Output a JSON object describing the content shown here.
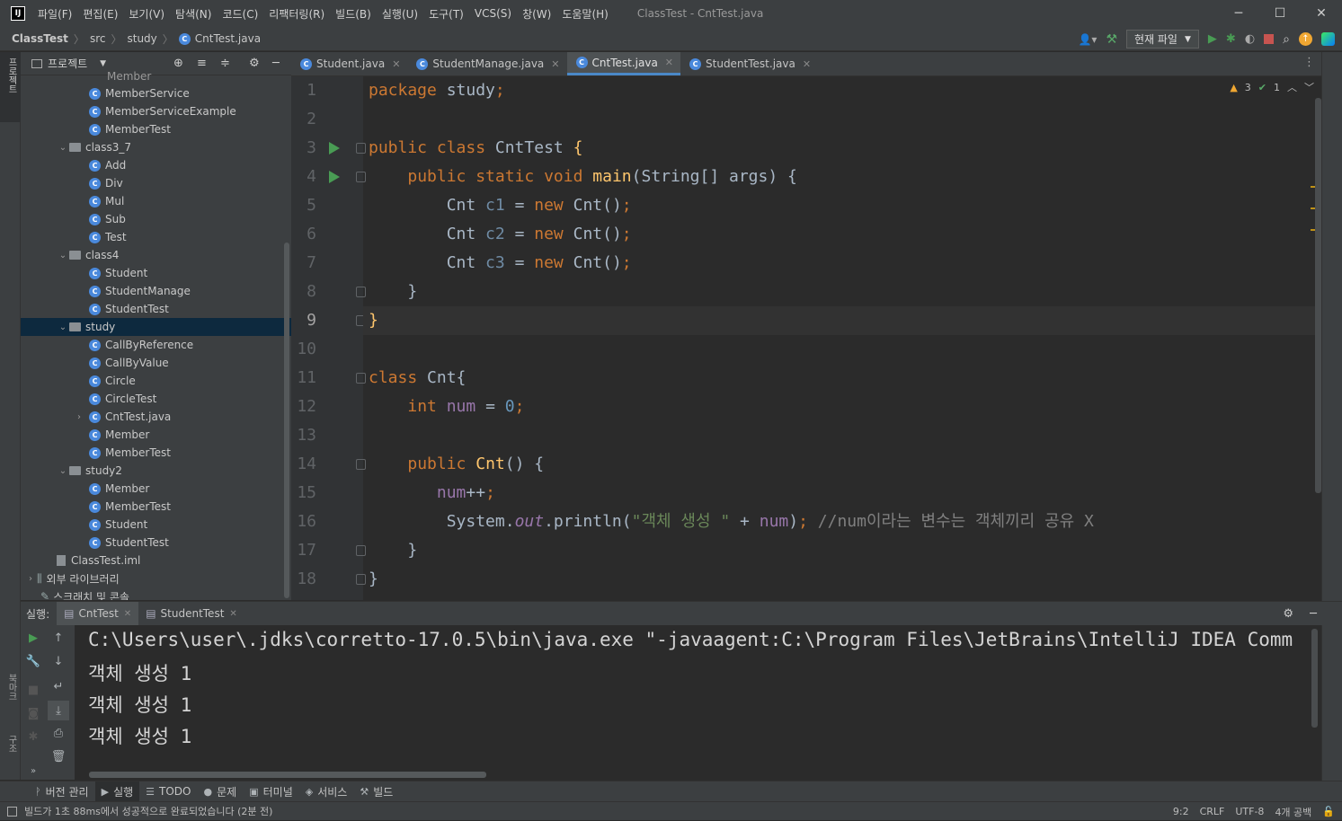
{
  "titlebar": {
    "logo": "IJ",
    "menu": [
      "파일(F)",
      "편집(E)",
      "보기(V)",
      "탐색(N)",
      "코드(C)",
      "리팩터링(R)",
      "빌드(B)",
      "실행(U)",
      "도구(T)",
      "VCS(S)",
      "창(W)",
      "도움말(H)"
    ],
    "title": "ClassTest - CntTest.java",
    "minimize": "─",
    "maximize": "☐",
    "close": "✕"
  },
  "navbar": {
    "crumbs": [
      "ClassTest",
      "src",
      "study",
      "CntTest.java"
    ],
    "run_config": "현재 파일"
  },
  "left_stripe": {
    "project_label": "프로젝트",
    "bookmarks_label": "북마크",
    "structure_label": "구조"
  },
  "project": {
    "title": "프로젝트",
    "tree": [
      {
        "label": "MemberService",
        "type": "class",
        "depth": 2
      },
      {
        "label": "MemberServiceExample",
        "type": "class",
        "depth": 2
      },
      {
        "label": "MemberTest",
        "type": "class",
        "depth": 2
      },
      {
        "label": "class3_7",
        "type": "package",
        "depth": 1,
        "expanded": true
      },
      {
        "label": "Add",
        "type": "class",
        "depth": 2
      },
      {
        "label": "Div",
        "type": "class",
        "depth": 2
      },
      {
        "label": "Mul",
        "type": "class",
        "depth": 2
      },
      {
        "label": "Sub",
        "type": "class",
        "depth": 2
      },
      {
        "label": "Test",
        "type": "class",
        "depth": 2
      },
      {
        "label": "class4",
        "type": "package",
        "depth": 1,
        "expanded": true
      },
      {
        "label": "Student",
        "type": "class",
        "depth": 2
      },
      {
        "label": "StudentManage",
        "type": "class",
        "depth": 2
      },
      {
        "label": "StudentTest",
        "type": "class",
        "depth": 2
      },
      {
        "label": "study",
        "type": "package",
        "depth": 1,
        "expanded": true,
        "selected": true
      },
      {
        "label": "CallByReference",
        "type": "class",
        "depth": 2
      },
      {
        "label": "CallByValue",
        "type": "class",
        "depth": 2
      },
      {
        "label": "Circle",
        "type": "class",
        "depth": 2
      },
      {
        "label": "CircleTest",
        "type": "class",
        "depth": 2
      },
      {
        "label": "CntTest.java",
        "type": "file",
        "depth": 2,
        "collapsed": true
      },
      {
        "label": "Member",
        "type": "class",
        "depth": 2
      },
      {
        "label": "MemberTest",
        "type": "class",
        "depth": 2
      },
      {
        "label": "study2",
        "type": "package",
        "depth": 1,
        "expanded": true
      },
      {
        "label": "Member",
        "type": "class",
        "depth": 2
      },
      {
        "label": "MemberTest",
        "type": "class",
        "depth": 2
      },
      {
        "label": "Student",
        "type": "class",
        "depth": 2
      },
      {
        "label": "StudentTest",
        "type": "class",
        "depth": 2
      },
      {
        "label": "ClassTest.iml",
        "type": "iml",
        "depth": 1
      },
      {
        "label": "외부 라이브러리",
        "type": "lib",
        "depth": 0
      },
      {
        "label": "스크래치 및 콘솔",
        "type": "scratch",
        "depth": 0
      }
    ]
  },
  "editor_tabs": [
    {
      "label": "Student.java",
      "active": false
    },
    {
      "label": "StudentManage.java",
      "active": false
    },
    {
      "label": "CntTest.java",
      "active": true
    },
    {
      "label": "StudentTest.java",
      "active": false
    }
  ],
  "inspection": {
    "warnings": "3",
    "ok": "1"
  },
  "editor": {
    "current_line": 9,
    "lines": [
      {
        "n": "1",
        "html": "<span class='kw'>package</span> study<span class='kw'>;</span>"
      },
      {
        "n": "2",
        "html": ""
      },
      {
        "n": "3",
        "html": "<span class='kw'>public class</span> CntTest <span class='fn'>{</span>",
        "run": true,
        "fold": true
      },
      {
        "n": "4",
        "html": "    <span class='kw'>public static void</span> <span class='fn'>main</span>(String[] args) {",
        "run": true,
        "fold": true
      },
      {
        "n": "5",
        "html": "        Cnt <span class='loc'>c1</span> = <span class='kw'>new</span> Cnt()<span class='kw'>;</span>"
      },
      {
        "n": "6",
        "html": "        Cnt <span class='loc'>c2</span> = <span class='kw'>new</span> Cnt()<span class='kw'>;</span>"
      },
      {
        "n": "7",
        "html": "        Cnt <span class='loc'>c3</span> = <span class='kw'>new</span> Cnt()<span class='kw'>;</span>"
      },
      {
        "n": "8",
        "html": "    }",
        "fold": true
      },
      {
        "n": "9",
        "html": "<span class='fn'>}</span>",
        "fold": true
      },
      {
        "n": "10",
        "html": ""
      },
      {
        "n": "11",
        "html": "<span class='kw'>class</span> Cnt{",
        "fold": true
      },
      {
        "n": "12",
        "html": "    <span class='kw'>int</span> <span class='fld'>num</span> = <span class='num'>0</span><span class='kw'>;</span>"
      },
      {
        "n": "13",
        "html": ""
      },
      {
        "n": "14",
        "html": "    <span class='kw'>public</span> <span class='fn'>Cnt</span>() {",
        "fold": true
      },
      {
        "n": "15",
        "html": "       <span class='fld'>num</span>++<span class='kw'>;</span>"
      },
      {
        "n": "16",
        "html": "        System.<span class='fld ital'>out</span>.println(<span class='str'>\"객체 생성 \"</span> + <span class='fld'>num</span>)<span class='kw'>;</span> <span class='cmt'>//num이라는 변수는 객체끼리 공유 X</span>"
      },
      {
        "n": "17",
        "html": "    }",
        "fold": true
      },
      {
        "n": "18",
        "html": "}",
        "fold": true
      }
    ]
  },
  "run": {
    "label": "실행:",
    "tabs": [
      {
        "label": "CntTest",
        "active": true
      },
      {
        "label": "StudentTest",
        "active": false
      }
    ],
    "console": [
      "C:\\Users\\user\\.jdks\\corretto-17.0.5\\bin\\java.exe \"-javaagent:C:\\Program Files\\JetBrains\\IntelliJ IDEA Comm",
      "객체 생성 1",
      "객체 생성 1",
      "객체 생성 1"
    ]
  },
  "bottom_tabs": [
    {
      "label": "버전 관리",
      "icon": "ᚹ",
      "active": false
    },
    {
      "label": "실행",
      "icon": "▶",
      "active": true
    },
    {
      "label": "TODO",
      "icon": "☰",
      "active": false
    },
    {
      "label": "문제",
      "icon": "●",
      "active": false
    },
    {
      "label": "터미널",
      "icon": "▣",
      "active": false
    },
    {
      "label": "서비스",
      "icon": "◈",
      "active": false
    },
    {
      "label": "빌드",
      "icon": "⚒",
      "active": false
    }
  ],
  "status": {
    "message": "빌드가 1초 88ms에서 성공적으로 완료되었습니다 (2분 전)",
    "position": "9:2",
    "line_sep": "CRLF",
    "encoding": "UTF-8",
    "indent": "4개 공백"
  }
}
